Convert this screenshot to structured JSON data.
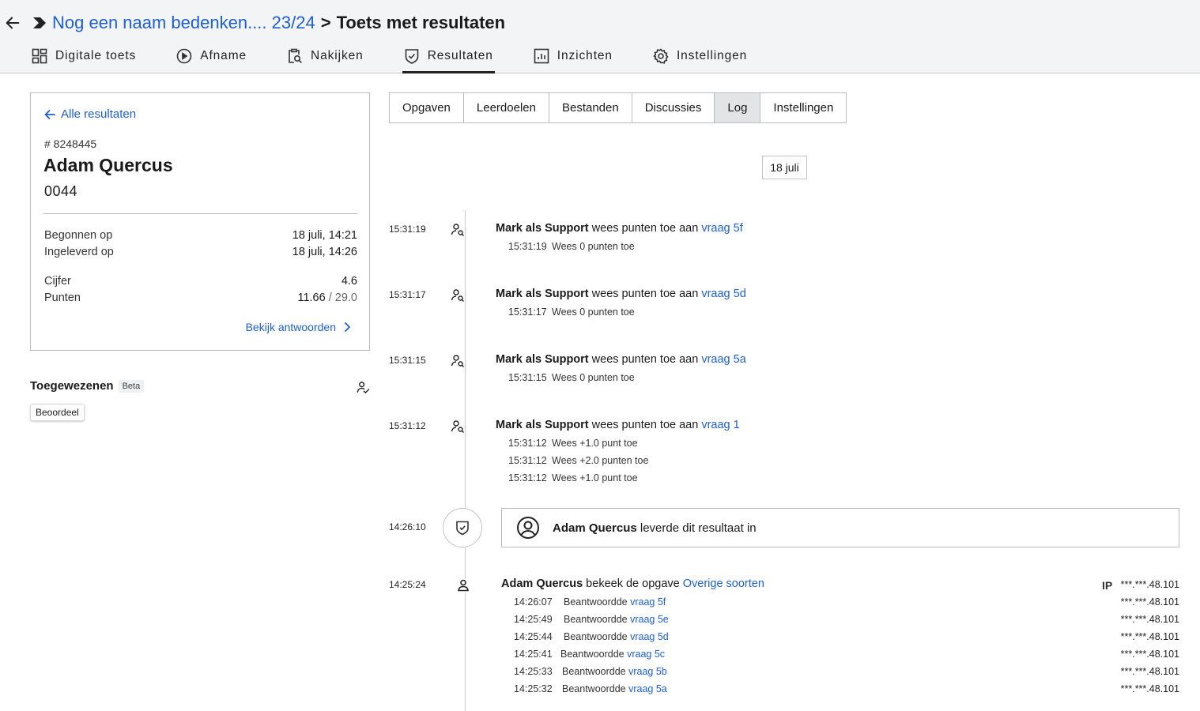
{
  "header": {
    "breadcrumb_parent": "Nog een naam bedenken.... 23/24",
    "breadcrumb_sep": ">",
    "breadcrumb_current": "Toets met resultaten",
    "tabs": [
      {
        "label": "Digitale toets",
        "icon": "grid-icon"
      },
      {
        "label": "Afname",
        "icon": "play-circle-icon"
      },
      {
        "label": "Nakijken",
        "icon": "clipboard-search-icon"
      },
      {
        "label": "Resultaten",
        "icon": "shield-check-icon",
        "active": true
      },
      {
        "label": "Inzichten",
        "icon": "bar-chart-icon"
      },
      {
        "label": "Instellingen",
        "icon": "gear-icon"
      }
    ]
  },
  "card": {
    "back_label": "Alle resultaten",
    "id": "# 8248445",
    "name": "Adam Quercus",
    "number": "0044",
    "started_label": "Begonnen op",
    "started_value": "18 juli, 14:21",
    "submitted_label": "Ingeleverd op",
    "submitted_value": "18 juli, 14:26",
    "grade_label": "Cijfer",
    "grade_value": "4.6",
    "points_label": "Punten",
    "points_value": "11.66",
    "points_sep": "/",
    "points_max": "29.0",
    "view_answers": "Bekijk antwoorden"
  },
  "assigned": {
    "title": "Toegewezenen",
    "badge": "Beta",
    "pill": "Beoordeel"
  },
  "subtabs": [
    "Opgaven",
    "Leerdoelen",
    "Bestanden",
    "Discussies",
    "Log",
    "Instellingen"
  ],
  "active_subtab": "Log",
  "log_date": "18 juli",
  "log": [
    {
      "time": "15:31:19",
      "actor": "Mark als Support",
      "text": " wees punten toe aan ",
      "link": "vraag 5f",
      "subs": [
        {
          "time": "15:31:19",
          "text": "Wees 0 punten toe"
        }
      ]
    },
    {
      "time": "15:31:17",
      "actor": "Mark als Support",
      "text": " wees punten toe aan ",
      "link": "vraag 5d",
      "subs": [
        {
          "time": "15:31:17",
          "text": "Wees 0 punten toe"
        }
      ]
    },
    {
      "time": "15:31:15",
      "actor": "Mark als Support",
      "text": " wees punten toe aan ",
      "link": "vraag 5a",
      "subs": [
        {
          "time": "15:31:15",
          "text": "Wees 0 punten toe"
        }
      ]
    },
    {
      "time": "15:31:12",
      "actor": "Mark als Support",
      "text": " wees punten toe aan ",
      "link": "vraag 1",
      "subs": [
        {
          "time": "15:31:12",
          "text": "Wees +1.0 punt toe"
        },
        {
          "time": "15:31:12",
          "text": "Wees +2.0 punten toe"
        },
        {
          "time": "15:31:12",
          "text": "Wees +1.0 punt toe"
        }
      ]
    }
  ],
  "submit_event": {
    "time": "14:26:10",
    "actor": "Adam Quercus",
    "text": " leverde dit resultaat in"
  },
  "view_event": {
    "time": "14:25:24",
    "actor": "Adam Quercus",
    "text": " bekeek de opgave ",
    "link": "Overige soorten",
    "ip_label": "IP",
    "ip": "***.***.48.101",
    "subs": [
      {
        "time": "14:26:07",
        "text": "Beantwoordde",
        "link": "vraag 5f",
        "ip": "***.***.48.101"
      },
      {
        "time": "14:25:49",
        "text": "Beantwoordde",
        "link": "vraag 5e",
        "ip": "***.***.48.101"
      },
      {
        "time": "14:25:44",
        "text": "Beantwoordde",
        "link": "vraag 5d",
        "ip": "***.***.48.101"
      },
      {
        "time": "14:25:41",
        "text": "Beantwoordde",
        "link": "vraag 5c",
        "ip": "***.***.48.101"
      },
      {
        "time": "14:25:33",
        "text": "Beantwoordde",
        "link": "vraag 5b",
        "ip": "***.***.48.101"
      },
      {
        "time": "14:25:32",
        "text": "Beantwoordde",
        "link": "vraag 5a",
        "ip": "***.***.48.101"
      }
    ]
  },
  "colors": {
    "link": "#1f5fcf",
    "header_bg": "#f3f4f5",
    "active_subtab_bg": "#e3e4e6"
  }
}
